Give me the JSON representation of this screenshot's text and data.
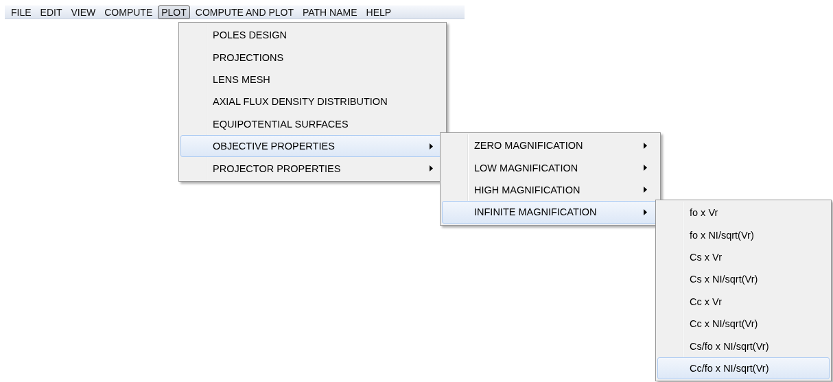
{
  "menubar": {
    "items": [
      {
        "label": "FILE",
        "selected": false
      },
      {
        "label": "EDIT",
        "selected": false
      },
      {
        "label": "VIEW",
        "selected": false
      },
      {
        "label": "COMPUTE",
        "selected": false
      },
      {
        "label": "PLOT",
        "selected": true
      },
      {
        "label": "COMPUTE AND PLOT",
        "selected": false
      },
      {
        "label": "PATH NAME",
        "selected": false
      },
      {
        "label": "HELP",
        "selected": false
      }
    ]
  },
  "menus": [
    {
      "items": [
        {
          "label": "POLES DESIGN",
          "submenu": false,
          "selected": false
        },
        {
          "label": "PROJECTIONS",
          "submenu": false,
          "selected": false
        },
        {
          "label": "LENS MESH",
          "submenu": false,
          "selected": false
        },
        {
          "label": "AXIAL FLUX DENSITY DISTRIBUTION",
          "submenu": false,
          "selected": false
        },
        {
          "label": "EQUIPOTENTIAL SURFACES",
          "submenu": false,
          "selected": false
        },
        {
          "label": "OBJECTIVE PROPERTIES",
          "submenu": true,
          "selected": true
        },
        {
          "label": "PROJECTOR PROPERTIES",
          "submenu": true,
          "selected": false
        }
      ]
    },
    {
      "items": [
        {
          "label": "ZERO MAGNIFICATION",
          "submenu": true,
          "selected": false
        },
        {
          "label": "LOW MAGNIFICATION",
          "submenu": true,
          "selected": false
        },
        {
          "label": "HIGH MAGNIFICATION",
          "submenu": true,
          "selected": false
        },
        {
          "label": "INFINITE MAGNIFICATION",
          "submenu": true,
          "selected": true
        }
      ]
    },
    {
      "items": [
        {
          "label": "fo x Vr",
          "submenu": false,
          "selected": false
        },
        {
          "label": "fo x NI/sqrt(Vr)",
          "submenu": false,
          "selected": false
        },
        {
          "label": "Cs x Vr",
          "submenu": false,
          "selected": false
        },
        {
          "label": "Cs x NI/sqrt(Vr)",
          "submenu": false,
          "selected": false
        },
        {
          "label": "Cc x Vr",
          "submenu": false,
          "selected": false
        },
        {
          "label": "Cc x NI/sqrt(Vr)",
          "submenu": false,
          "selected": false
        },
        {
          "label": "Cs/fo x NI/sqrt(Vr)",
          "submenu": false,
          "selected": false
        },
        {
          "label": "Cc/fo x NI/sqrt(Vr)",
          "submenu": false,
          "selected": true
        }
      ]
    }
  ]
}
